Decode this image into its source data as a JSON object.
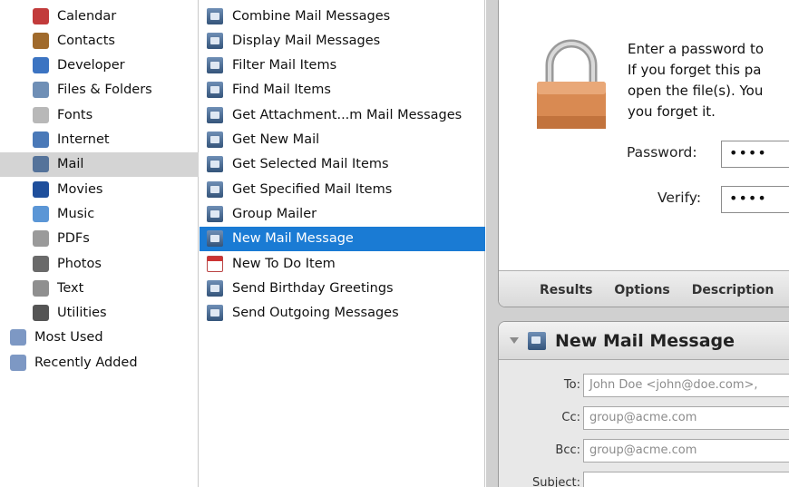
{
  "library": {
    "items": [
      {
        "label": "Calendar",
        "icon": "calendar-icon",
        "color": "#c23b3b",
        "selected": false,
        "indent": 1
      },
      {
        "label": "Contacts",
        "icon": "contacts-icon",
        "color": "#a06a2c",
        "selected": false,
        "indent": 1
      },
      {
        "label": "Developer",
        "icon": "developer-icon",
        "color": "#3c74c2",
        "selected": false,
        "indent": 1
      },
      {
        "label": "Files & Folders",
        "icon": "files-folders-icon",
        "color": "#6f8fb6",
        "selected": false,
        "indent": 1
      },
      {
        "label": "Fonts",
        "icon": "fonts-icon",
        "color": "#b8b8b8",
        "selected": false,
        "indent": 1
      },
      {
        "label": "Internet",
        "icon": "internet-icon",
        "color": "#4a79b8",
        "selected": false,
        "indent": 1
      },
      {
        "label": "Mail",
        "icon": "mail-icon",
        "color": "#55739a",
        "selected": true,
        "indent": 1
      },
      {
        "label": "Movies",
        "icon": "movies-icon",
        "color": "#1f4f9c",
        "selected": false,
        "indent": 1
      },
      {
        "label": "Music",
        "icon": "music-icon",
        "color": "#5b96d6",
        "selected": false,
        "indent": 1
      },
      {
        "label": "PDFs",
        "icon": "pdfs-icon",
        "color": "#9a9a9a",
        "selected": false,
        "indent": 1
      },
      {
        "label": "Photos",
        "icon": "photos-icon",
        "color": "#6a6a6a",
        "selected": false,
        "indent": 1
      },
      {
        "label": "Text",
        "icon": "text-icon",
        "color": "#8f8f8f",
        "selected": false,
        "indent": 1
      },
      {
        "label": "Utilities",
        "icon": "utilities-icon",
        "color": "#555555",
        "selected": false,
        "indent": 1
      },
      {
        "label": "Most Used",
        "icon": "smart-folder-icon",
        "color": "#7d98c4",
        "selected": false,
        "indent": 0
      },
      {
        "label": "Recently Added",
        "icon": "smart-folder-icon",
        "color": "#7d98c4",
        "selected": false,
        "indent": 0
      }
    ]
  },
  "actions": {
    "items": [
      {
        "label": "Combine Mail Messages",
        "icon": "mail-action-icon",
        "selected": false
      },
      {
        "label": "Display Mail Messages",
        "icon": "mail-action-icon",
        "selected": false
      },
      {
        "label": "Filter Mail Items",
        "icon": "mail-action-icon",
        "selected": false
      },
      {
        "label": "Find Mail Items",
        "icon": "mail-action-icon",
        "selected": false
      },
      {
        "label": "Get Attachment...m Mail Messages",
        "icon": "mail-action-icon",
        "selected": false
      },
      {
        "label": "Get New Mail",
        "icon": "mail-action-icon",
        "selected": false
      },
      {
        "label": "Get Selected Mail Items",
        "icon": "mail-action-icon",
        "selected": false
      },
      {
        "label": "Get Specified Mail Items",
        "icon": "mail-action-icon",
        "selected": false
      },
      {
        "label": "Group Mailer",
        "icon": "mail-action-icon",
        "selected": false
      },
      {
        "label": "New Mail Message",
        "icon": "mail-action-icon",
        "selected": true
      },
      {
        "label": "New To Do Item",
        "icon": "todo-calendar-icon",
        "selected": false
      },
      {
        "label": "Send Birthday Greetings",
        "icon": "mail-action-icon",
        "selected": false
      },
      {
        "label": "Send Outgoing Messages",
        "icon": "mail-action-icon",
        "selected": false
      }
    ]
  },
  "password_action": {
    "message_lines": [
      "Enter a password to",
      "If you forget this pa",
      "open the file(s). You",
      "you forget it."
    ],
    "password_label": "Password:",
    "password_value": "••••",
    "verify_label": "Verify:",
    "verify_value": "••••",
    "tabs": [
      "Results",
      "Options",
      "Description"
    ]
  },
  "mail_action": {
    "title": "New Mail Message",
    "to_label": "To:",
    "to_value": "John Doe <john@doe.com>,",
    "cc_label": "Cc:",
    "cc_value": "group@acme.com",
    "bcc_label": "Bcc:",
    "bcc_value": "group@acme.com",
    "subject_label": "Subject:",
    "subject_value": ""
  },
  "colors": {
    "selection_blue": "#1a7bd4",
    "selection_gray": "#d4d4d4",
    "lock_body": "#d98a52"
  }
}
